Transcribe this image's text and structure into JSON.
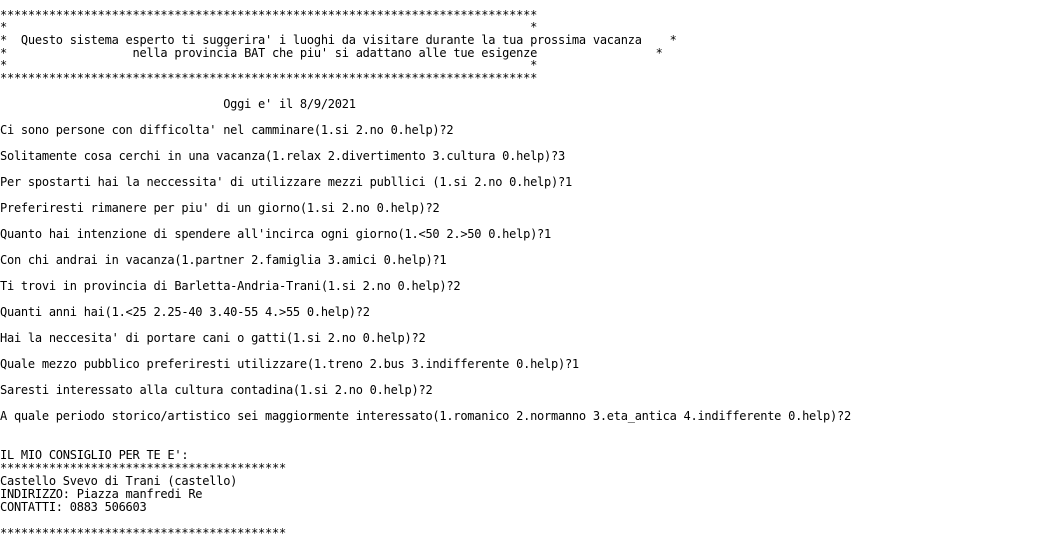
{
  "banner": {
    "border": "*****************************************************************************",
    "blank_line": "*                                                                           *",
    "line1": "*  Questo sistema esperto ti suggerira' i luoghi da visitare durante la tua prossima vacanza    *",
    "line2": "*                  nella provincia BAT che piu' si adattano alle tue esigenze                 *"
  },
  "date_line": "                                Oggi e' il 8/9/2021",
  "questions": [
    {
      "text": "Ci sono persone con difficolta' nel camminare(1.si 2.no 0.help)?",
      "answer": "2"
    },
    {
      "text": "Solitamente cosa cerchi in una vacanza(1.relax 2.divertimento 3.cultura 0.help)?",
      "answer": "3"
    },
    {
      "text": "Per spostarti hai la neccessita' di utilizzare mezzi publlici (1.si 2.no 0.help)?",
      "answer": "1"
    },
    {
      "text": "Preferiresti rimanere per piu' di un giorno(1.si 2.no 0.help)?",
      "answer": "2"
    },
    {
      "text": "Quanto hai intenzione di spendere all'incirca ogni giorno(1.<50 2.>50 0.help)?",
      "answer": "1"
    },
    {
      "text": "Con chi andrai in vacanza(1.partner 2.famiglia 3.amici 0.help)?",
      "answer": "1"
    },
    {
      "text": "Ti trovi in provincia di Barletta-Andria-Trani(1.si 2.no 0.help)?",
      "answer": "2"
    },
    {
      "text": "Quanti anni hai(1.<25 2.25-40 3.40-55 4.>55 0.help)?",
      "answer": "2"
    },
    {
      "text": "Hai la neccesita' di portare cani o gatti(1.si 2.no 0.help)?",
      "answer": "2"
    },
    {
      "text": "Quale mezzo pubblico preferiresti utilizzare(1.treno 2.bus 3.indifferente 0.help)?",
      "answer": "1"
    },
    {
      "text": "Saresti interessato alla cultura contadina(1.si 2.no 0.help)?",
      "answer": "2"
    },
    {
      "text": "A quale periodo storico/artistico sei maggiormente interessato(1.romanico 2.normanno 3.eta_antica 4.indifferente 0.help)?",
      "answer": "2"
    }
  ],
  "result": {
    "heading": "IL MIO CONSIGLIO PER TE E':",
    "separator": "*****************************************",
    "place": "Castello Svevo di Trani (castello)",
    "address": "INDIRIZZO: Piazza manfredi Re",
    "contacts": "CONTATTI: 0883 506603",
    "end_separator": "*****************************************"
  }
}
